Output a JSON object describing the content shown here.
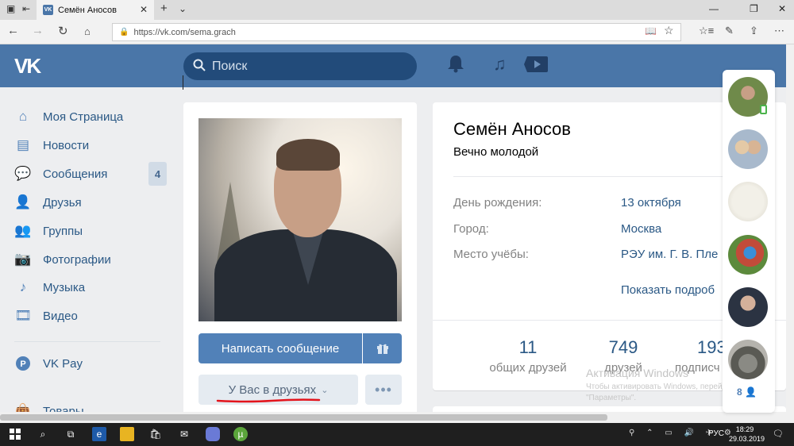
{
  "browser": {
    "tab_title": "Семён Аносов",
    "favicon_text": "VK",
    "url": "https://vk.com/sema.grach",
    "icons": [
      "tab-switch-icon",
      "back-tab-icon",
      "close-tab-icon",
      "new-tab-icon",
      "tab-dropdown-icon",
      "minimize-icon",
      "maximize-icon",
      "close-window-icon",
      "back-icon",
      "forward-icon",
      "refresh-icon",
      "home-icon",
      "lock-icon",
      "reading-view-icon",
      "favorite-star-icon",
      "favorites-list-icon",
      "pen-icon",
      "share-icon",
      "more-icon"
    ]
  },
  "vk_header": {
    "logo": "VK",
    "search_placeholder": "Поиск",
    "icons": [
      "bell-icon",
      "music-note-icon",
      "video-play-icon"
    ]
  },
  "menu": {
    "items": [
      {
        "label": "Моя Страница",
        "icon": "home-icon"
      },
      {
        "label": "Новости",
        "icon": "news-icon"
      },
      {
        "label": "Сообщения",
        "icon": "chat-icon",
        "badge": "4"
      },
      {
        "label": "Друзья",
        "icon": "person-icon"
      },
      {
        "label": "Группы",
        "icon": "group-icon"
      },
      {
        "label": "Фотографии",
        "icon": "camera-icon"
      },
      {
        "label": "Музыка",
        "icon": "music-icon"
      },
      {
        "label": "Видео",
        "icon": "film-icon"
      },
      {
        "label": "VK Pay",
        "icon": "vkpay-icon"
      },
      {
        "label": "Товары",
        "icon": "bag-icon"
      }
    ]
  },
  "profile": {
    "name": "Семён Аносов",
    "status": "Вечно молодой",
    "write_button": "Написать сообщение",
    "friends_button": "У Вас в друзьях",
    "more_button": "•••",
    "info": [
      {
        "label": "День рождения:",
        "value": "13 октября"
      },
      {
        "label": "Город:",
        "value": "Москва"
      },
      {
        "label": "Место учёбы:",
        "value": "РЭУ им. Г. В. Пле"
      }
    ],
    "show_more": "Показать подроб",
    "counters": [
      {
        "number": "11",
        "label": "общих друзей"
      },
      {
        "number": "749",
        "label": "друзей"
      },
      {
        "number": "193",
        "label": "подписч"
      }
    ]
  },
  "watermark": {
    "title": "Активация Windows",
    "text": "Чтобы активировать Windows, перейдите в раздел \"Параметры\"."
  },
  "friends_online": {
    "count": "8"
  },
  "taskbar": {
    "language": "РУС",
    "time": "18:29",
    "date": "29.03.2019"
  },
  "colors": {
    "vk_blue": "#4a76a8",
    "button_blue": "#5181b8",
    "link": "#2a5885",
    "underline_red": "#e3141c"
  }
}
